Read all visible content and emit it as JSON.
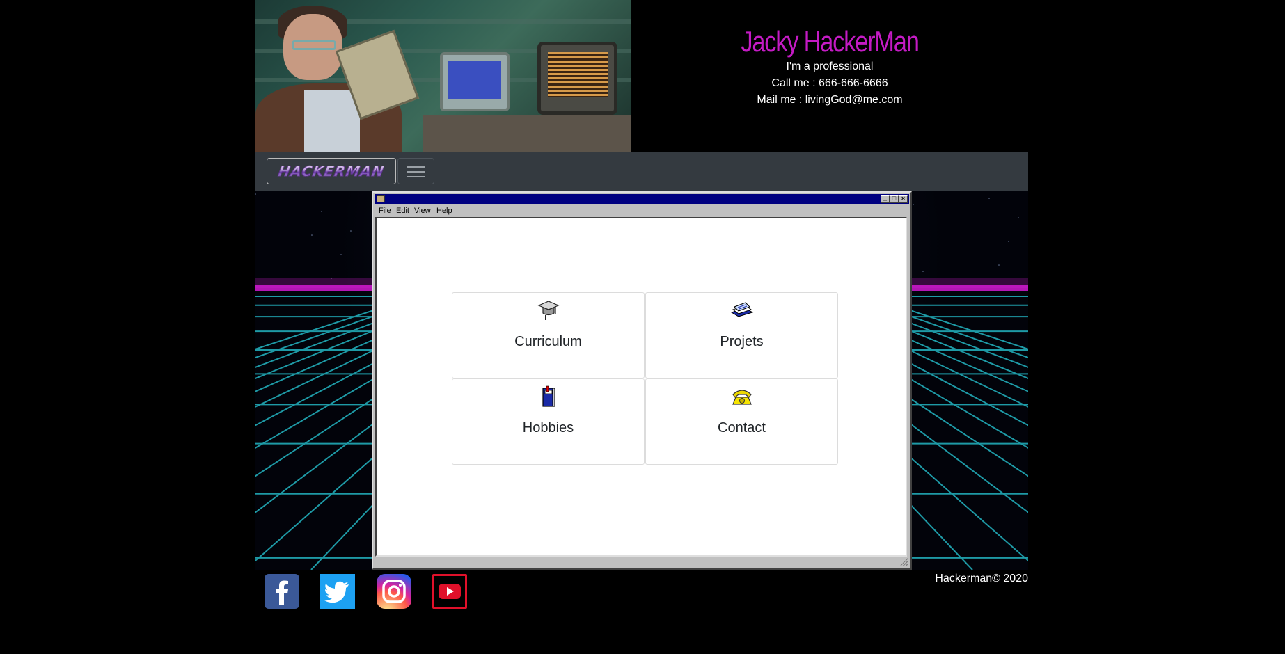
{
  "profile": {
    "name": "Jacky HackerMan",
    "tagline": "I'm a professional",
    "phone": "Call me : 666-666-6666",
    "email": "Mail me : livingGod@me.com"
  },
  "navbar": {
    "brand": "HACKERMAN",
    "toggle_icon": "hamburger-icon"
  },
  "window": {
    "app_icon": "folder-icon",
    "controls": [
      "minimize",
      "maximize",
      "close"
    ],
    "menu": [
      "File",
      "Edit",
      "View",
      "Help"
    ]
  },
  "cards": [
    {
      "label": "Curriculum",
      "icon": "graduation-cap-icon"
    },
    {
      "label": "Projets",
      "icon": "stack-of-papers-icon"
    },
    {
      "label": "Hobbies",
      "icon": "book-icon"
    },
    {
      "label": "Contact",
      "icon": "telephone-icon"
    }
  ],
  "footer": {
    "social": [
      "facebook",
      "twitter",
      "instagram",
      "youtube"
    ],
    "copyright": "Hackerman© 2020"
  },
  "colors": {
    "name": "#c41bc4",
    "navbar": "#343a40",
    "titlebar": "#000080",
    "grid": "#1e9aa6",
    "horizon": "#d21ad2"
  }
}
